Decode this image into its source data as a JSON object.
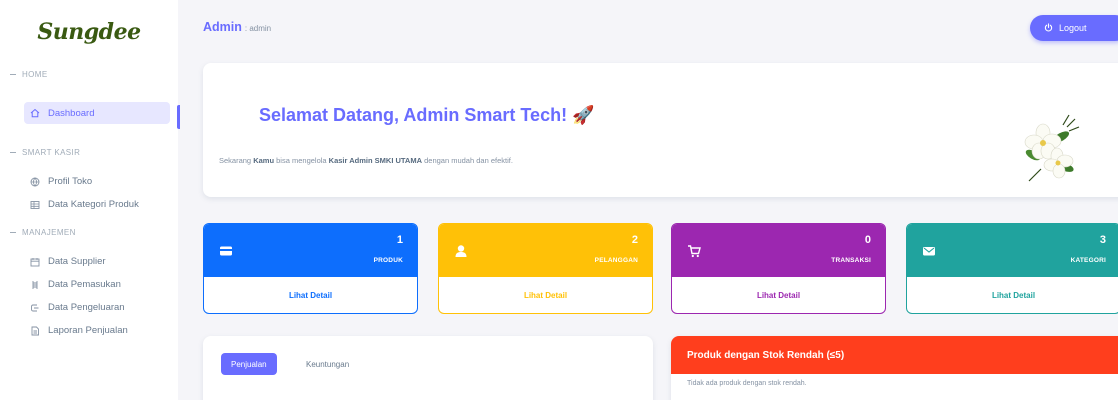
{
  "sidebar": {
    "logo": "Sungdee",
    "sections": {
      "home": "HOME",
      "smart_kasir": "SMART KASIR",
      "manajemen": "MANAJEMEN"
    },
    "items": [
      {
        "label": "Dashboard",
        "icon": "home-icon"
      },
      {
        "label": "Profil Toko",
        "icon": "globe-icon"
      },
      {
        "label": "Data Kategori Produk",
        "icon": "table-icon"
      },
      {
        "label": "Data Supplier",
        "icon": "calendar-icon"
      },
      {
        "label": "Data Pemasukan",
        "icon": "receipt-icon"
      },
      {
        "label": "Data Pengeluaran",
        "icon": "wallet-icon"
      },
      {
        "label": "Laporan Penjualan",
        "icon": "report-icon"
      }
    ]
  },
  "navbar": {
    "title": "Admin",
    "subtitle": ": admin",
    "logout_label": "Logout"
  },
  "welcome": {
    "heading": "Selamat Datang, Admin Smart Tech! 🚀",
    "text_pre": "Sekarang ",
    "text_bold1": "Kamu",
    "text_mid": " bisa mengelola ",
    "text_bold2": "Kasir Admin SMKI UTAMA",
    "text_post": " dengan mudah dan efektif."
  },
  "stats": [
    {
      "value": "1",
      "label": "PRODUK",
      "link": "Lihat Detail",
      "color": "#0d6efd",
      "icon": "wallet-icon"
    },
    {
      "value": "2",
      "label": "PELANGGAN",
      "link": "Lihat Detail",
      "color": "#ffc107",
      "icon": "user-icon"
    },
    {
      "value": "0",
      "label": "TRANSAKSI",
      "link": "Lihat Detail",
      "color": "#9c27b0",
      "icon": "cart-icon"
    },
    {
      "value": "3",
      "label": "KATEGORI",
      "link": "Lihat Detail",
      "color": "#20a39e",
      "icon": "mail-icon"
    }
  ],
  "tabs": {
    "active": "Penjualan",
    "other": "Keuntungan"
  },
  "low_stock": {
    "title": "Produk dengan Stok Rendah (≤5)",
    "empty_text": "Tidak ada produk dengan stok rendah."
  },
  "colors": {
    "primary": "#696cff",
    "danger": "#ff3e1d"
  }
}
